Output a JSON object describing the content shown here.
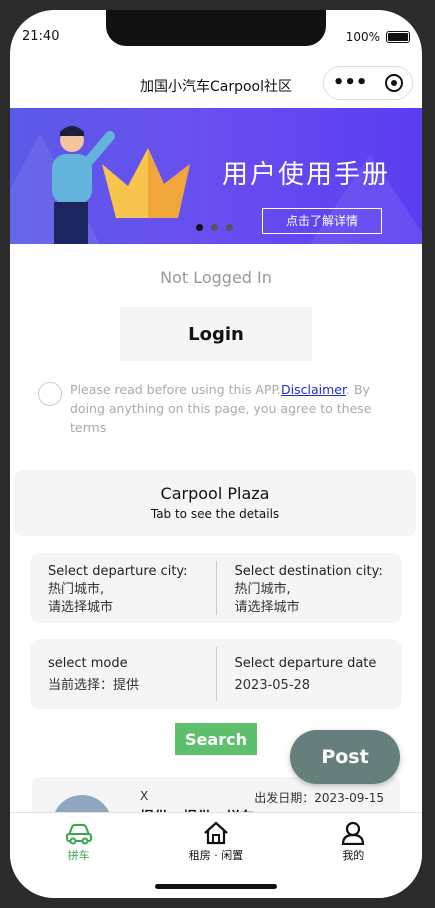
{
  "status": {
    "time": "21:40",
    "battery": "100%"
  },
  "nav": {
    "title": "加国小汽车Carpool社区"
  },
  "banner": {
    "title": "用户使用手册",
    "button": "点击了解详情"
  },
  "login": {
    "status": "Not Logged In",
    "button": "Login"
  },
  "disclaimer": {
    "prefix": "Please read before using this APP.",
    "link": "Disclaimer",
    "suffix": ". By doing anything on this page, you agree to these terms"
  },
  "plaza": {
    "title": "Carpool Plaza",
    "subtitle": "Tab to see the details"
  },
  "route": {
    "departure_label": "Select departure city:",
    "departure_hot": "热门城市,",
    "departure_choose": "请选择城市",
    "destination_label": "Select destination city:",
    "destination_hot": "热门城市,",
    "destination_choose": "请选择城市"
  },
  "mode": {
    "label": "select mode",
    "value": "当前选择：提供",
    "date_label": "Select departure date",
    "date_value": "2023-05-28"
  },
  "actions": {
    "search": "Search",
    "post": "Post"
  },
  "list": {
    "mode": "X",
    "date": "出发日期：2023-09-15",
    "title": "提供 · 提供 · 拼车"
  },
  "tabs": [
    {
      "label": "拼车",
      "icon": "car-icon"
    },
    {
      "label": "租房 · 闲置",
      "icon": "house-icon"
    },
    {
      "label": "我的",
      "icon": "person-icon"
    }
  ],
  "colors": {
    "accent": "#3aa64a",
    "search": "#5ec06c",
    "post": "#667f7c",
    "banner": "#5b5ae8",
    "link": "#1d2dd8"
  }
}
